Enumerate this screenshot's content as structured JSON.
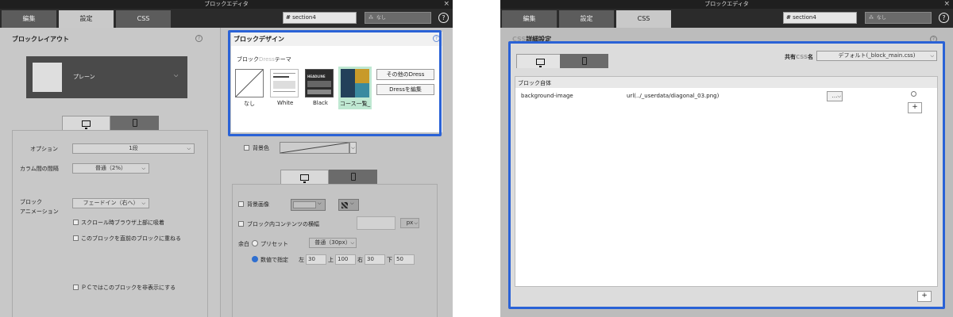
{
  "window": {
    "title": "ブロックエディタ",
    "close": "×",
    "help": "?"
  },
  "tabs": [
    "編集",
    "設定",
    "CSS"
  ],
  "section_field": "section4",
  "hash": "#",
  "position_select": "なし",
  "left": {
    "layout": {
      "title": "ブロックレイアウト",
      "help": "?",
      "selected": "プレーン"
    },
    "options": {
      "option_label": "オプション",
      "option_value": "1段",
      "gap_label": "カラム間の間隔",
      "gap_value": "普通（2%）",
      "anim_label_1": "ブロック",
      "anim_label_2": "アニメーション",
      "anim_value": "フェードイン（右へ）",
      "scroll_check": "スクロール時ブラウザ上部に吸着",
      "overlap_check": "このブロックを直前のブロックに重ねる",
      "pc_hide_check": "ＰＣではこのブロックを非表示にする"
    },
    "design": {
      "title": "ブロックデザイン",
      "help": "?",
      "theme_label_prefix": "ブロック",
      "theme_label_dress": "Dress",
      "theme_label_suffix": "テーマ",
      "themes": [
        "なし",
        "White",
        "Black",
        "コース一覧_"
      ],
      "btn_other": "その他のDress",
      "btn_edit": "Dressを編集",
      "black_thumb_text": "HEADLINE"
    },
    "bg_color_label": "背景色",
    "bg": {
      "image_label": "背景画像",
      "width_label": "ブロック内コンテンツの横幅",
      "unit": "px",
      "margin_label": "余白",
      "preset_label": "プリセット",
      "preset_value": "普通（30px）",
      "numeric_label": "数値で指定",
      "left_label": "左",
      "left_val": "30",
      "top_label": "上",
      "top_val": "100",
      "right_label": "右",
      "right_val": "30",
      "bottom_label": "下",
      "bottom_val": "50"
    }
  },
  "right": {
    "css_section_title_prefix": "CSS",
    "css_section_title": "詳細設定",
    "help": "?",
    "shared_label_1": "共有",
    "shared_label_css": "CSS",
    "shared_label_2": "名",
    "shared_value": "デフォルト(_block_main.css)",
    "block_self_title": "ブロック自体",
    "property": "background-image",
    "value": "url(../_userdata/diagonal_03.png)",
    "important_select": "…",
    "add_label": "+"
  },
  "colors": {
    "highlight": "#2a62d6",
    "radio_on": "#2f6fd0",
    "teal": "#2f6f7f",
    "gold": "#c89a2a"
  }
}
